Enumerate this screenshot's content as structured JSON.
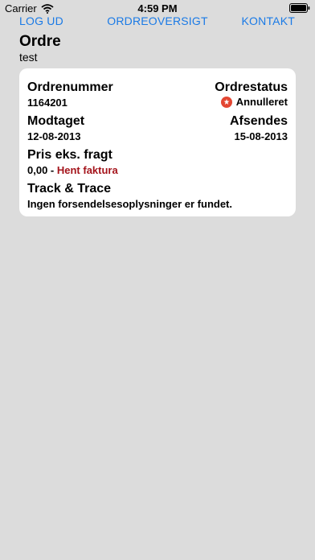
{
  "status_bar": {
    "carrier": "Carrier",
    "time": "4:59 PM"
  },
  "nav": {
    "logout": "LOG UD",
    "overview": "ORDREOVERSIGT",
    "contact": "KONTAKT"
  },
  "page": {
    "title": "Ordre",
    "subtitle": "test"
  },
  "order": {
    "number_label": "Ordrenummer",
    "number_value": "1164201",
    "status_label": "Ordrestatus",
    "status_value": "Annulleret",
    "received_label": "Modtaget",
    "received_value": "12-08-2013",
    "ships_label": "Afsendes",
    "ships_value": "15-08-2013",
    "price_label": "Pris eks. fragt",
    "price_value": "0,00",
    "price_separator": " - ",
    "invoice_link": "Hent faktura",
    "track_label": "Track & Trace",
    "track_value": "Ingen forsendelsesoplysninger er fundet."
  },
  "colors": {
    "accent": "#1a7ae6",
    "link_red": "#a4141b",
    "cancel_icon": "#e34632",
    "background": "#dcdcdc"
  },
  "icons": [
    "wifi-icon",
    "battery-icon",
    "cancel-icon"
  ]
}
